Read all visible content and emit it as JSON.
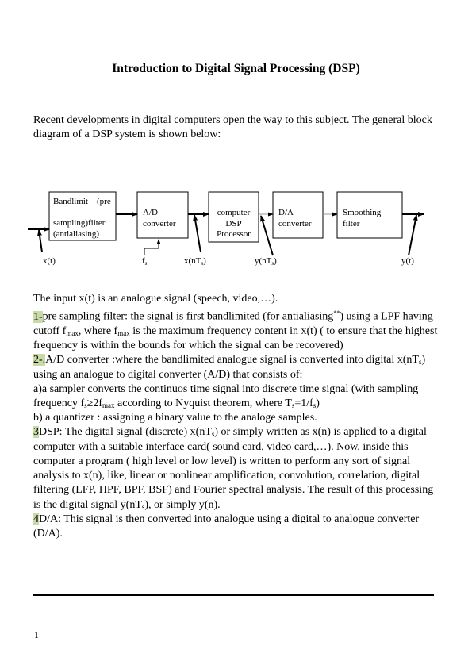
{
  "title": "Introduction to Digital Signal Processing (DSP)",
  "intro": "Recent developments in digital computers open the way to this subject. The general block diagram of a DSP system is shown below:",
  "diagram": {
    "blocks": [
      {
        "line1": "Bandlimit    (pre",
        "line2": "-",
        "line3": "sampling)filter",
        "line4": "(antialiasing)"
      },
      {
        "line1": "A/D",
        "line2": "converter"
      },
      {
        "line1": "computer",
        "line2": "DSP",
        "line3": "Processor"
      },
      {
        "line1": "D/A",
        "line2": "converter"
      },
      {
        "line1": "Smoothing",
        "line2": "filter"
      }
    ],
    "labels": {
      "xt": "x(t)",
      "fs_f": "f",
      "fs_s": "s",
      "xnts_a": "x(nT",
      "xnts_s": "s",
      "xnts_b": ")",
      "ynts_a": "y(nT",
      "ynts_s": "s",
      "ynts_b": ")",
      "yt": "y(t)"
    }
  },
  "body": {
    "p1": "The input x(t) is an analogue signal (speech, video,…).",
    "s1_num": "1-",
    "s1_a": "pre sampling filter: the signal is first bandlimited (for antialiasing",
    "s1_sup": "**",
    "s1_b": ") using a LPF having cutoff f",
    "s1_sub1": "max",
    "s1_c": ", where f",
    "s1_sub2": "max",
    "s1_d": " is the maximum frequency content in x(t) ( to ensure that the highest frequency is within the bounds for which the signal can be recovered)",
    "s2_num": "2-.",
    "s2_a": "A/D converter :where the bandlimited analogue signal is  converted into digital x(nT",
    "s2_sub1": "s",
    "s2_b": ") using an analogue to digital converter (A/D) that consists of:",
    "s2_c": "a)a sampler converts the continuos time signal into discrete time signal  (with sampling frequency f",
    "s2_sub2": "s",
    "s2_d": "≥2f",
    "s2_sub3": "max",
    "s2_e": " according to Nyquist theorem, where T",
    "s2_sub4": "s",
    "s2_f": "=1/f",
    "s2_sub5": "s",
    "s2_g": ")",
    "s2_h": "b) a quantizer : assigning a binary value to the analoge samples.",
    "s3_num": "3",
    "s3_a": "DSP: The digital signal (discrete) x(nT",
    "s3_sub1": "s",
    "s3_b": ") or simply written as x(n) is  applied to a digital computer with a suitable interface card( sound card, video card,…). Now, inside this computer a program ( high level or low level) is written to perform any sort of signal analysis to x(n), like, linear or nonlinear amplification, convolution, correlation, digital filtering (LFP, HPF, BPF, BSF) and Fourier spectral analysis. The result of this processing is the digital signal y(nT",
    "s3_sub2": "s",
    "s3_c": "), or simply y(n).",
    "s4_num": "4",
    "s4_a": "D/A: This signal is then converted into analogue using a digital to analogue converter (D/A)."
  },
  "footer": {
    "page_number": "1"
  },
  "colors": {
    "highlight": "#c9d9a7"
  }
}
